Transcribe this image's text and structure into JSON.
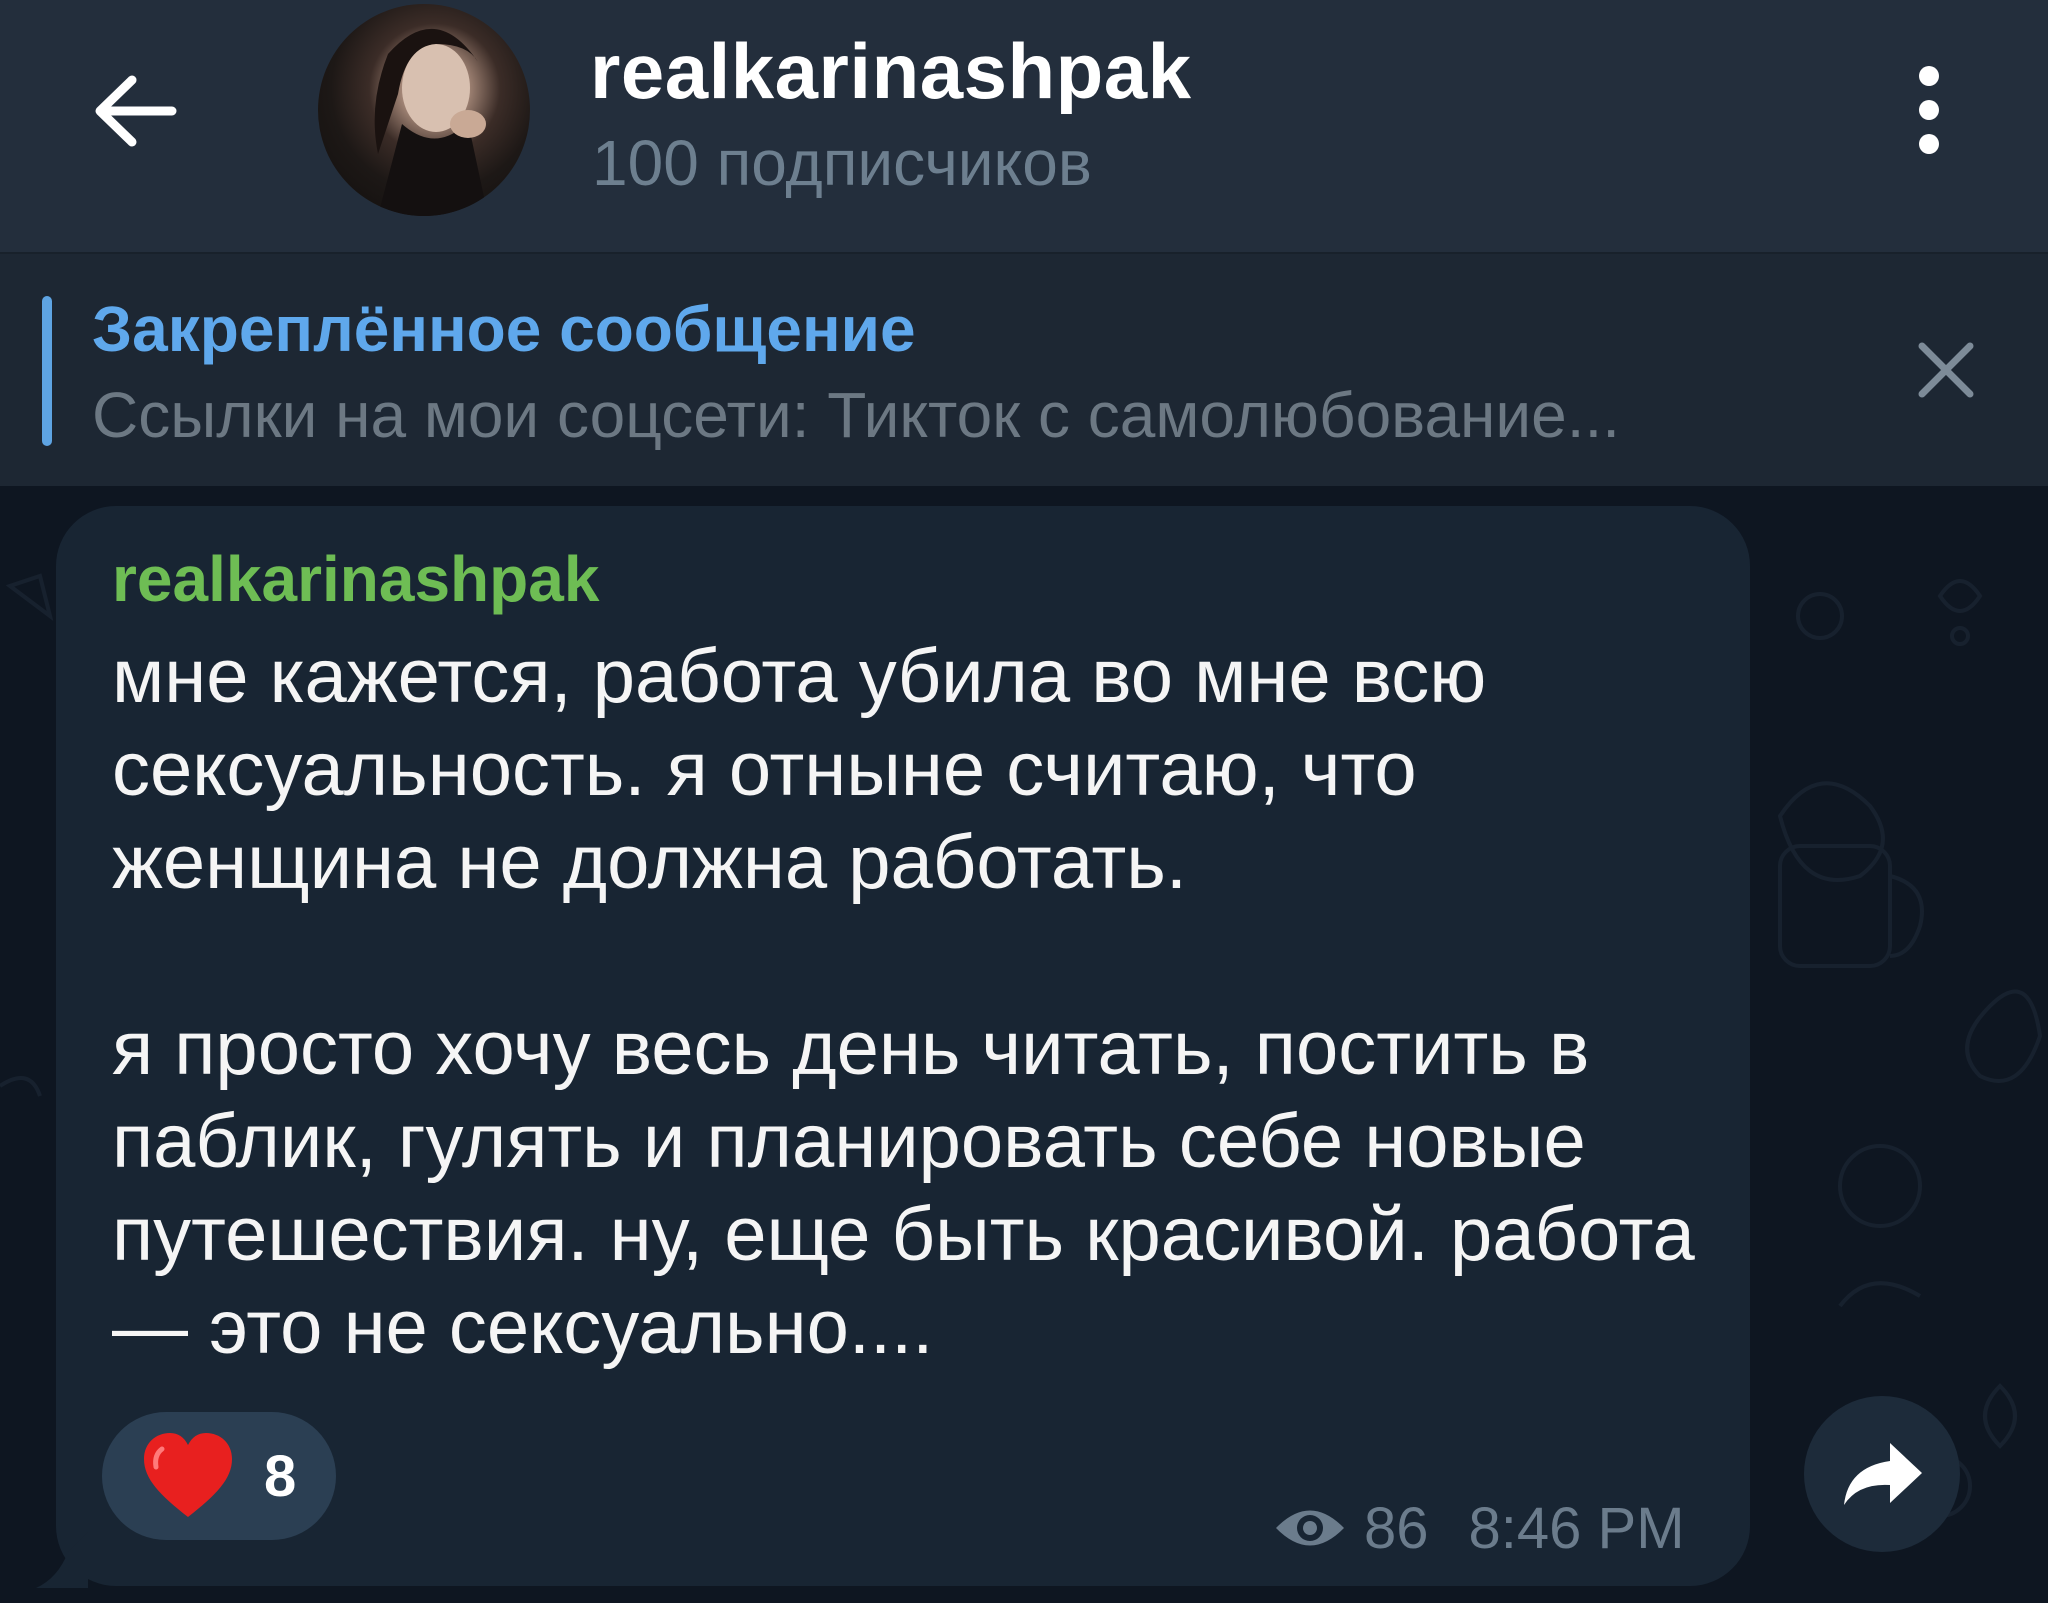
{
  "header": {
    "channel_name": "realkarinashpak",
    "subscribers": "100 подписчиков"
  },
  "pinned": {
    "title": "Закреплённое сообщение",
    "text": "Ссылки на мои соцсети:   Тикток с самолюбование..."
  },
  "message": {
    "sender": "realkarinashpak",
    "text": "мне кажется, работа убила во мне всю сексуальность. я отныне считаю, что женщина не должна работать.\n\nя просто хочу весь день читать, постить в паблик, гулять и планировать себе новые путешествия. ну, еще быть красивой. работа — это не сексуально....",
    "reaction_count": "8",
    "views": "86",
    "time": "8:46 PM"
  },
  "colors": {
    "header_bg": "#232e3c",
    "chat_bg": "#0e1621",
    "bubble_bg": "#182533",
    "accent_blue": "#5fa8ec",
    "sender_green": "#6ebd54",
    "muted": "#6b7c8c"
  },
  "icons": {
    "back": "arrow-left-icon",
    "more": "more-vertical-icon",
    "close": "close-icon",
    "reaction": "heart-icon",
    "views": "eye-icon",
    "share": "share-arrow-icon"
  }
}
